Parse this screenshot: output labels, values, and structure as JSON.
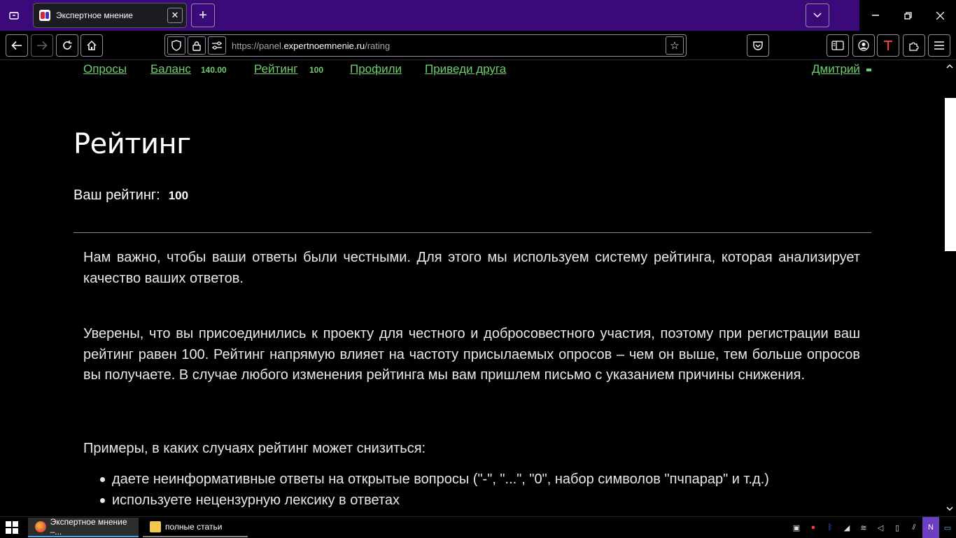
{
  "browser": {
    "tab": {
      "title": "Экспертное мнение",
      "close": "✕"
    },
    "new_tab": "+",
    "url": {
      "scheme": "https://panel.",
      "host": "expertnoemnenie.ru",
      "path": "/rating"
    }
  },
  "site_nav": {
    "surveys": "Опросы",
    "balance": "Баланс",
    "balance_value": "140.00",
    "rating": "Рейтинг",
    "rating_value": "100",
    "profiles": "Профили",
    "invite": "Приведи друга",
    "user": "Дмитрий"
  },
  "page": {
    "title": "Рейтинг",
    "rating_label": "Ваш рейтинг:",
    "rating_value": "100",
    "para1": "Нам важно, чтобы ваши ответы были честными. Для этого мы используем систему рейтинга, которая анализирует качество ваших ответов.",
    "para2": "Уверены, что вы присоединились к проекту для честного и добросовестного участия, поэтому при регистрации ваш рейтинг равен 100. Рейтинг напрямую влияет на частоту присылаемых опросов – чем он выше, тем больше опросов вы получаете. В случае любого изменения рейтинга мы вам пришлем письмо с указанием причины снижения.",
    "examples_title": "Примеры, в каких случаях рейтинг может снизиться:",
    "examples": [
      "даете неинформативные ответы на открытые вопросы (\"-\", \"...\", \"0\", набор символов \"пчпарар\" и т.д.)",
      "используете нецензурную лексику в ответах"
    ]
  },
  "taskbar": {
    "items": [
      "Экспертное мнение –...",
      "полные статьи"
    ]
  },
  "colors": {
    "tabbar": "#3b0a7a",
    "link": "#6fce6f"
  }
}
